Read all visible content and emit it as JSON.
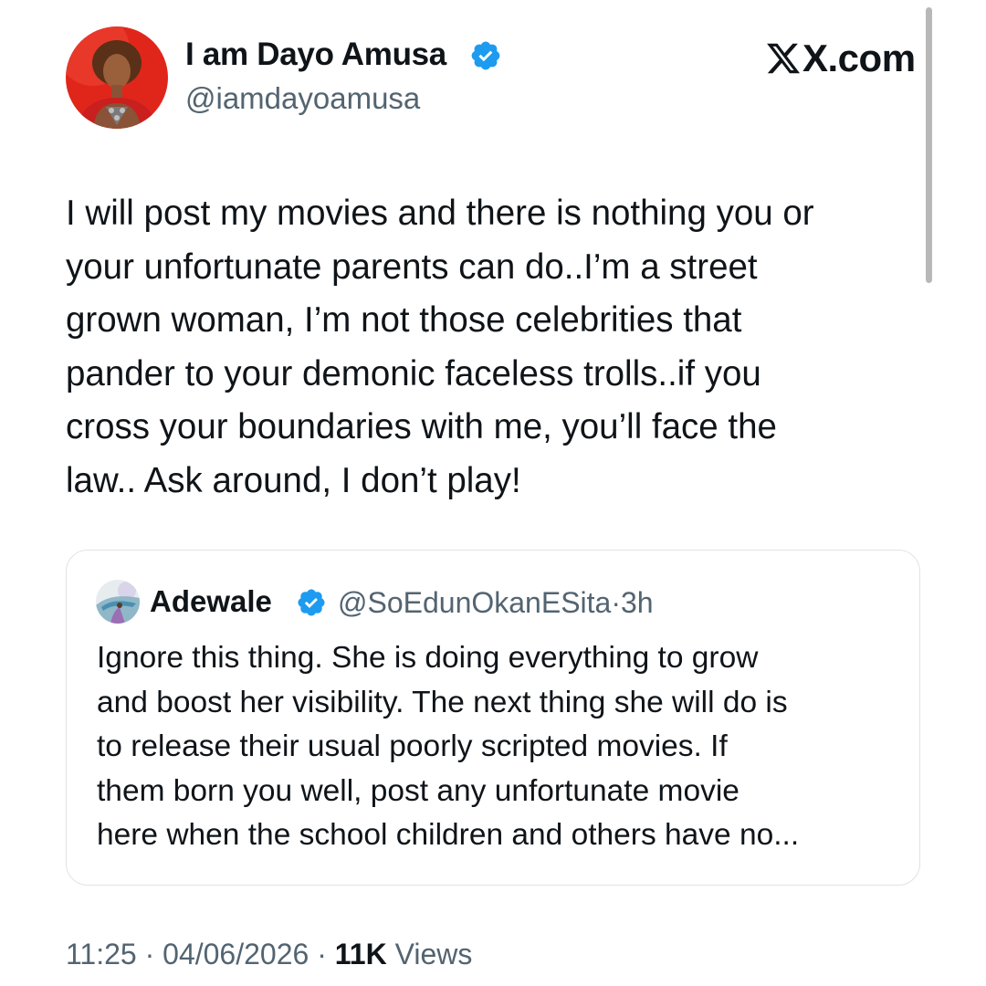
{
  "brand": {
    "label": "X.com"
  },
  "author": {
    "name": "I am Dayo Amusa",
    "handle": "@iamdayoamusa",
    "verified": true
  },
  "tweet": {
    "lines": [
      "I will post my movies and there is nothing you or",
      "your unfortunate parents can do..I’m a street",
      "grown woman, I’m not those celebrities that",
      "pander to your demonic faceless trolls..if you",
      "cross your boundaries with me, you’ll face the",
      "law.. Ask around, I don’t play!"
    ]
  },
  "quoted": {
    "name": "Adewale",
    "handle": "@SoEdunOkanESita",
    "separator": "·",
    "time": "3h",
    "verified": true,
    "lines": [
      "Ignore this thing. She is doing everything to grow",
      "and boost her visibility. The next thing she will do is",
      "to release their usual poorly scripted movies. If",
      "them born you well, post any unfortunate movie",
      "here when the school children and others have no..."
    ]
  },
  "footer": {
    "time": "11:25",
    "separator": "·",
    "date": "04/06/2026",
    "views_count": "11K",
    "views_label": "Views"
  },
  "colors": {
    "text": "#0f1419",
    "secondary": "#536471",
    "verified": "#1d9bf0",
    "border": "#dfe3e6",
    "avatar_bg": "#e0261b"
  },
  "icons": {
    "verified": "verified-badge-icon",
    "brand": "x-logo-icon"
  }
}
